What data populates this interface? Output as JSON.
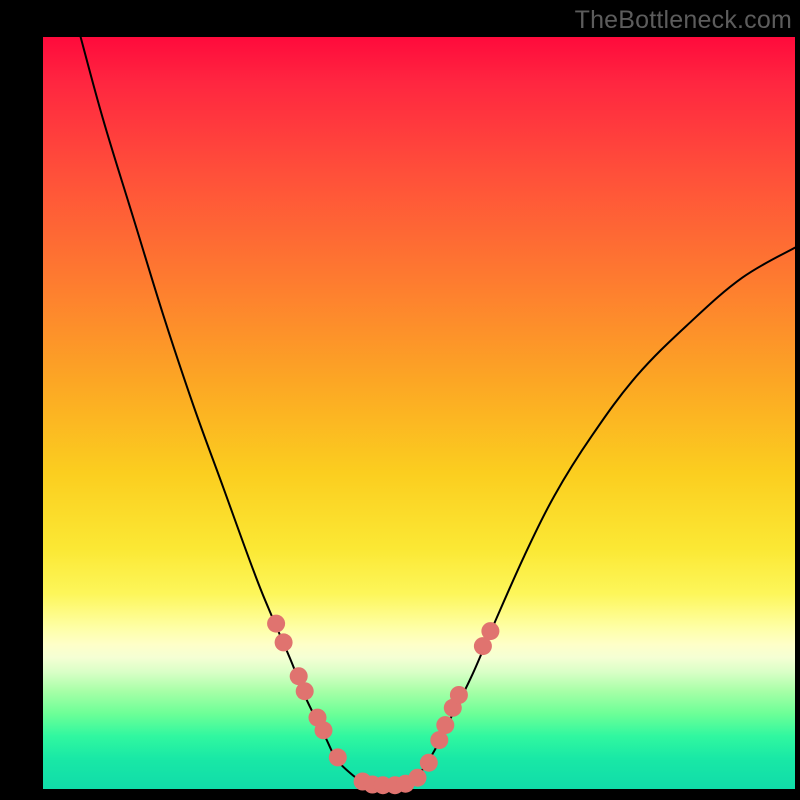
{
  "watermark": "TheBottleneck.com",
  "colors": {
    "background": "#000000",
    "curve": "#000000",
    "marker_fill": "#e0736f",
    "marker_stroke": "#c45a57",
    "gradient_stops": [
      "#ff0a3c",
      "#ff4f3a",
      "#fca724",
      "#fbe834",
      "#feffa5",
      "#a7ffa7",
      "#10dca9"
    ]
  },
  "chart_data": {
    "type": "line",
    "title": "",
    "xlabel": "",
    "ylabel": "",
    "xlim": [
      0,
      100
    ],
    "ylim": [
      0,
      100
    ],
    "grid": false,
    "legend": false,
    "note": "Values are approximate, read from pixel positions. y=0 is the bottom edge (green), y=100 is the top (red).",
    "series": [
      {
        "name": "left-branch",
        "x": [
          5,
          8,
          12,
          16,
          20,
          24,
          28,
          30,
          33,
          35,
          37.5,
          39,
          41,
          43
        ],
        "y": [
          100,
          89,
          76,
          63,
          51,
          40,
          29,
          24,
          17,
          12,
          7,
          4,
          2,
          0.5
        ]
      },
      {
        "name": "right-branch",
        "x": [
          48,
          50,
          52,
          54,
          57,
          60,
          64,
          68,
          73,
          79,
          86,
          93,
          100
        ],
        "y": [
          0.5,
          2,
          5,
          9,
          15,
          22,
          31,
          39,
          47,
          55,
          62,
          68,
          72
        ]
      },
      {
        "name": "valley-floor",
        "x": [
          43,
          44.5,
          46,
          47.5,
          48.5
        ],
        "y": [
          0.5,
          0.3,
          0.3,
          0.3,
          0.5
        ]
      }
    ],
    "markers": {
      "name": "dots",
      "note": "Salmon circular markers along lower portions of both branches and the valley floor",
      "points": [
        {
          "x": 31.0,
          "y": 22.0
        },
        {
          "x": 32.0,
          "y": 19.5
        },
        {
          "x": 34.0,
          "y": 15.0
        },
        {
          "x": 34.8,
          "y": 13.0
        },
        {
          "x": 36.5,
          "y": 9.5
        },
        {
          "x": 37.3,
          "y": 7.8
        },
        {
          "x": 39.2,
          "y": 4.2
        },
        {
          "x": 42.5,
          "y": 1.0
        },
        {
          "x": 43.8,
          "y": 0.6
        },
        {
          "x": 45.2,
          "y": 0.5
        },
        {
          "x": 46.8,
          "y": 0.5
        },
        {
          "x": 48.2,
          "y": 0.7
        },
        {
          "x": 49.8,
          "y": 1.5
        },
        {
          "x": 51.3,
          "y": 3.5
        },
        {
          "x": 52.7,
          "y": 6.5
        },
        {
          "x": 53.5,
          "y": 8.5
        },
        {
          "x": 54.5,
          "y": 10.8
        },
        {
          "x": 55.3,
          "y": 12.5
        },
        {
          "x": 58.5,
          "y": 19.0
        },
        {
          "x": 59.5,
          "y": 21.0
        }
      ]
    }
  }
}
